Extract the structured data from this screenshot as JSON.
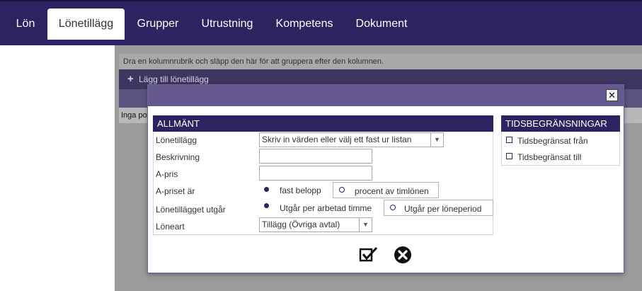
{
  "nav": {
    "tabs": [
      {
        "label": "Lön"
      },
      {
        "label": "Lönetillägg"
      },
      {
        "label": "Grupper"
      },
      {
        "label": "Utrustning"
      },
      {
        "label": "Kompetens"
      },
      {
        "label": "Dokument"
      }
    ],
    "active_tab": "Lönetillägg"
  },
  "background": {
    "group_hint": "Dra en kolumnrubrik och släpp den här för att gruppera efter den kolumnen.",
    "add_label": "Lägg till lönetillägg",
    "empty_text": "Inga po"
  },
  "dialog": {
    "general": {
      "title": "ALLMÄNT",
      "fields": {
        "lonetillagg_label": "Lönetillägg",
        "lonetillagg_placeholder": "Skriv in värden eller välj ett fast ur listan",
        "beskrivning_label": "Beskrivning",
        "beskrivning_value": "",
        "apris_label": "A-pris",
        "apris_value": "",
        "apriset_label": "A-priset är",
        "apriset_option1": "fast belopp",
        "apriset_option2": "procent av timlönen",
        "utgar_label": "Lönetillägget utgår",
        "utgar_option1": "Utgår per arbetad timme",
        "utgar_option2": "Utgår per löneperiod",
        "loneart_label": "Löneart",
        "loneart_value": "Tillägg (Övriga avtal)"
      }
    },
    "limits": {
      "title": "TIDSBEGRÄNSNINGAR",
      "from_label": "Tidsbegränsat från",
      "to_label": "Tidsbegränsat till"
    },
    "actions": {
      "save_icon": "checkbox-confirm-icon",
      "cancel_icon": "circle-x-icon"
    },
    "close_glyph": "✕"
  },
  "colors": {
    "nav_bg": "#2c2461",
    "modal_title_bg": "#65598f",
    "section_head_bg": "#2c2461"
  }
}
